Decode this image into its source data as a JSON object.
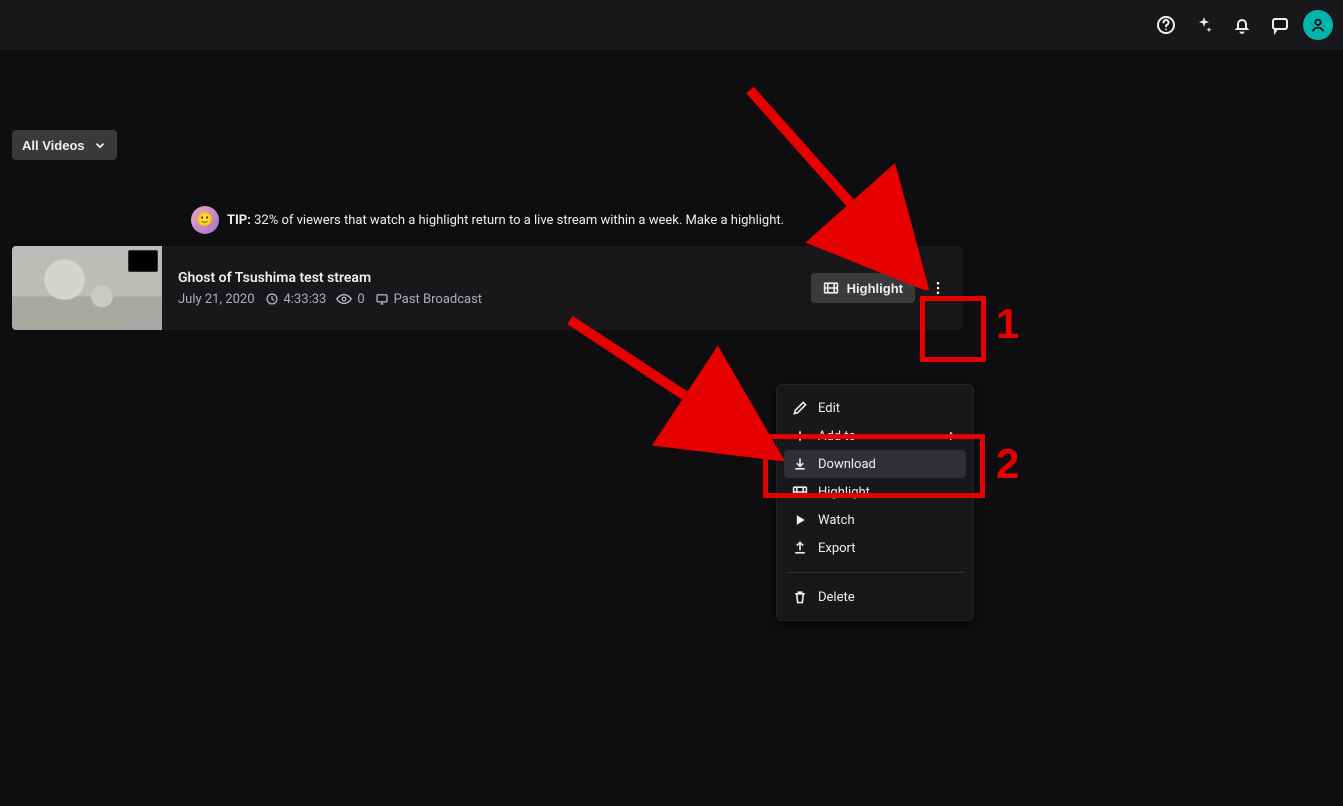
{
  "header": {
    "icons": [
      "help",
      "sparkle",
      "bell",
      "chat",
      "profile"
    ]
  },
  "filter": {
    "label": "All Videos"
  },
  "tip": {
    "prefix": "TIP:",
    "text": "32% of viewers that watch a highlight return to a live stream within a week. Make a highlight."
  },
  "video": {
    "title": "Ghost of Tsushima test stream",
    "date": "July 21, 2020",
    "duration": "4:33:33",
    "views": "0",
    "type": "Past Broadcast",
    "highlight_btn": "Highlight"
  },
  "menu": {
    "edit": "Edit",
    "add_to": "Add to",
    "download": "Download",
    "highlight": "Highlight",
    "watch": "Watch",
    "export": "Export",
    "delete": "Delete"
  },
  "annotations": {
    "one": "1",
    "two": "2"
  }
}
